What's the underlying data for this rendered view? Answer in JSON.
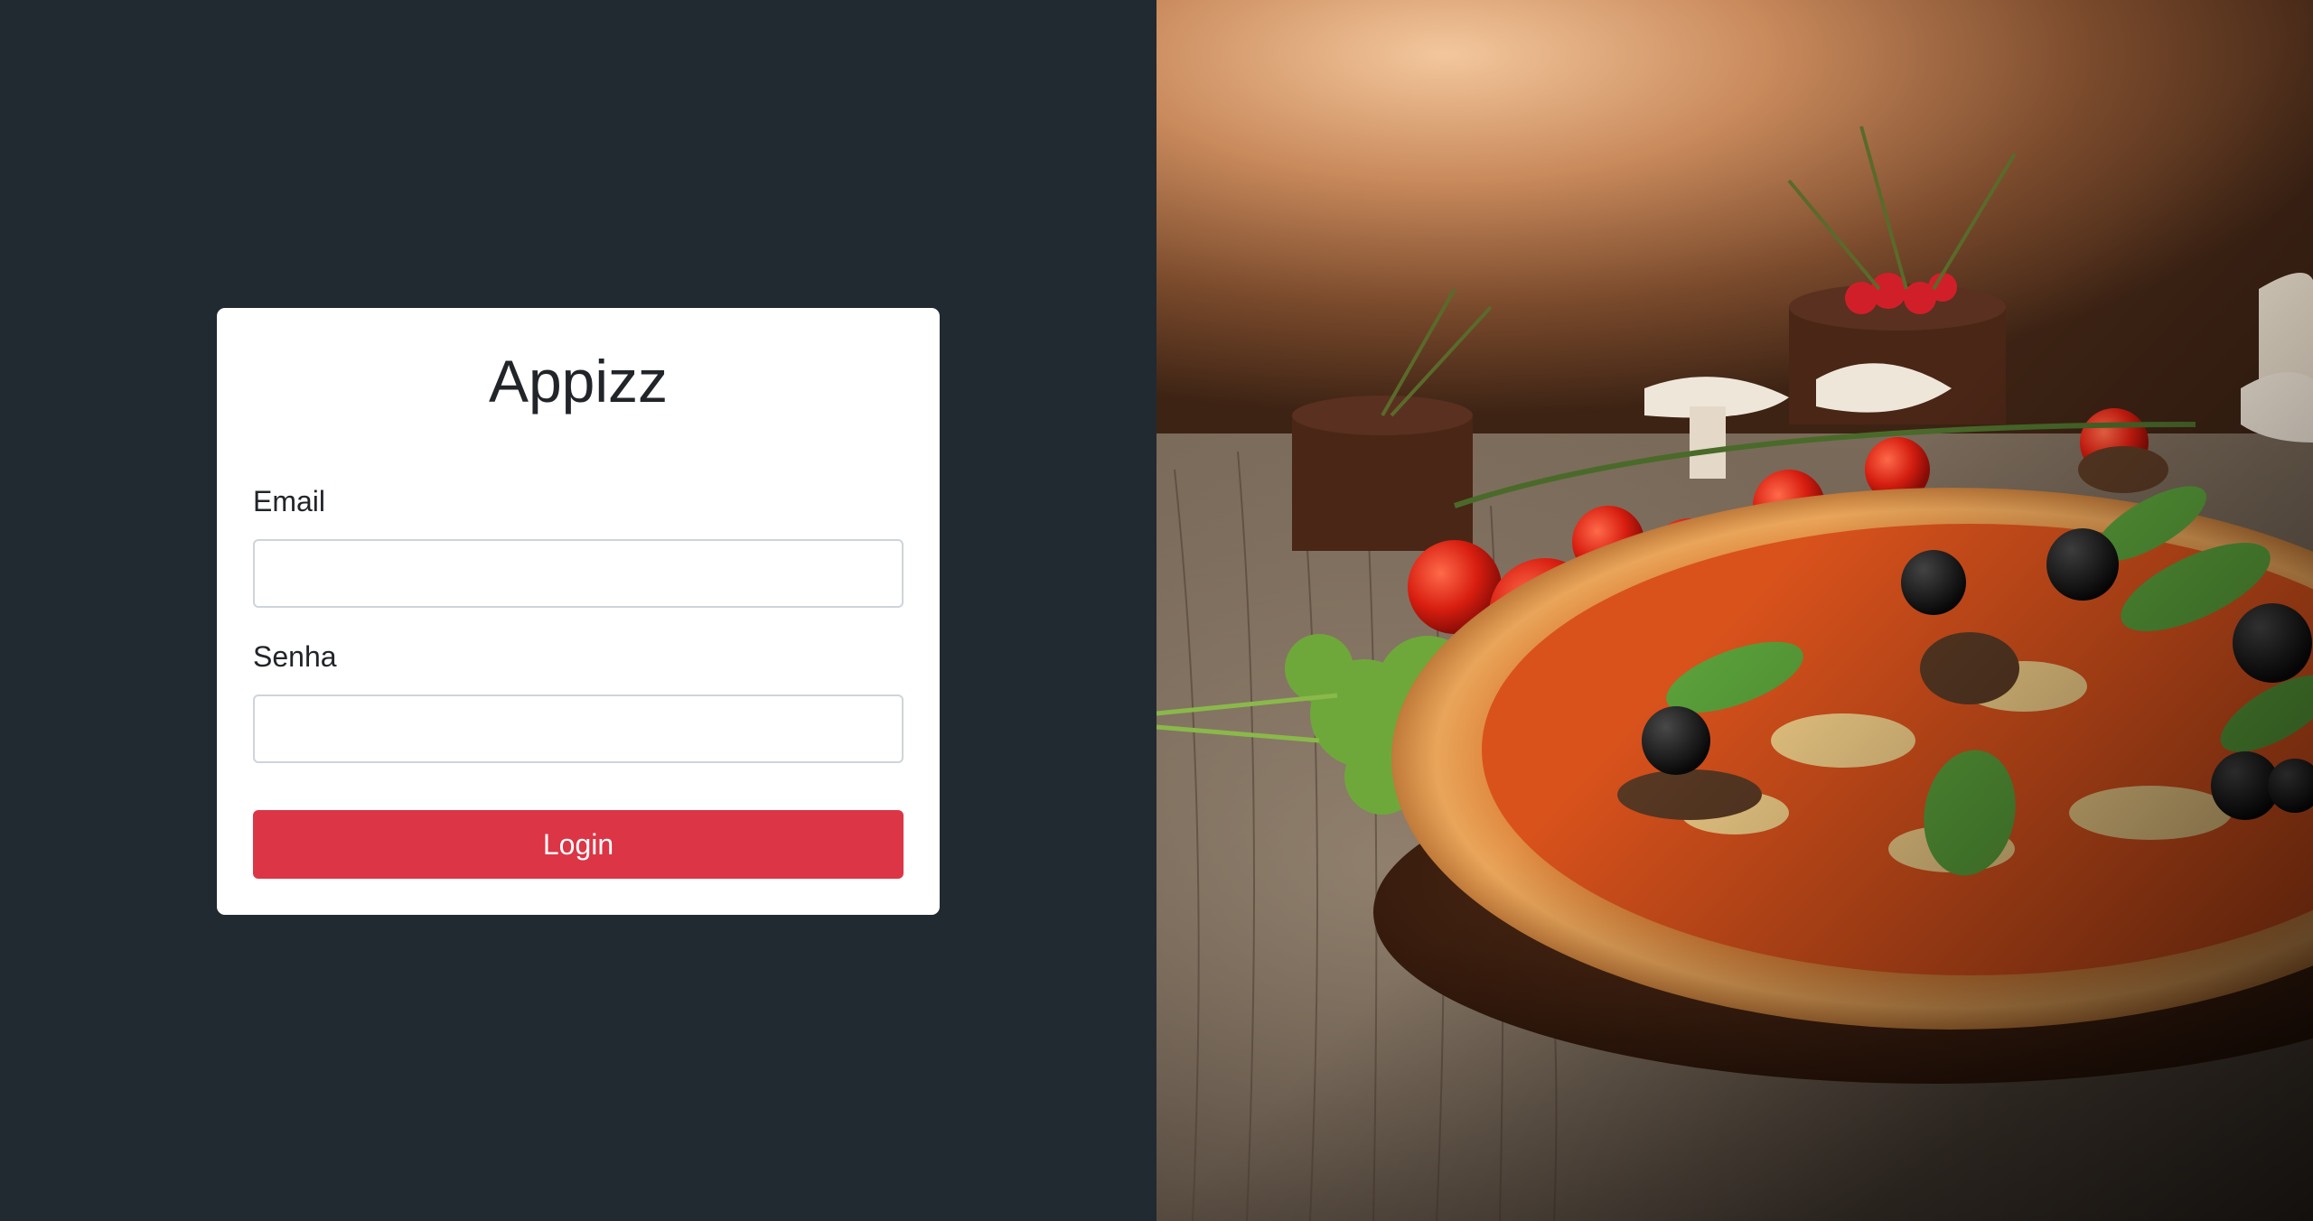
{
  "app": {
    "title": "Appizz"
  },
  "form": {
    "email_label": "Email",
    "email_value": "",
    "senha_label": "Senha",
    "senha_value": "",
    "login_label": "Login"
  },
  "colors": {
    "left_background": "#212a31",
    "card_background": "#ffffff",
    "button": "#dc3545"
  },
  "hero_image": {
    "subject": "pizza-photo"
  }
}
